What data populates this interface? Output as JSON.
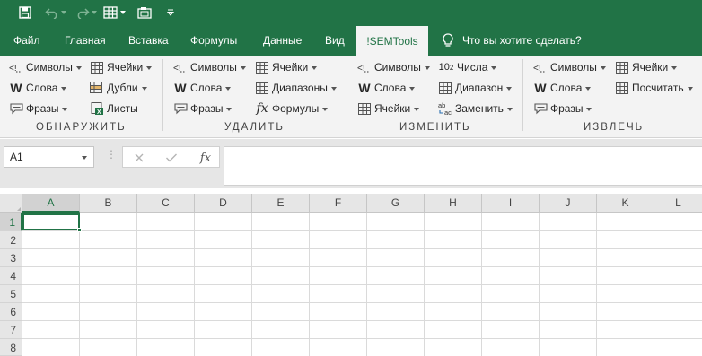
{
  "quick_access": {
    "icons": [
      "save-icon",
      "undo-icon",
      "redo-icon",
      "table-icon",
      "camera-icon",
      "customize-icon"
    ]
  },
  "tabs": [
    {
      "label": "Файл"
    },
    {
      "label": "Главная"
    },
    {
      "label": "Вставка"
    },
    {
      "label": "Формулы"
    },
    {
      "label": "Данные"
    },
    {
      "label": "Вид"
    },
    {
      "label": "!SEMTools",
      "active": true
    }
  ],
  "tell_me": {
    "label": "Что вы хотите сделать?"
  },
  "ribbon": {
    "detect": {
      "label": "ОБНАРУЖИТЬ",
      "symbols": "Символы",
      "cells": "Ячейки",
      "words": "Слова",
      "duplicates": "Дубли",
      "phrases": "Фразы",
      "sheets": "Листы"
    },
    "remove": {
      "label": "УДАЛИТЬ",
      "symbols": "Символы",
      "cells": "Ячейки",
      "words": "Слова",
      "ranges": "Диапазоны",
      "phrases": "Фразы",
      "formulas": "Формулы"
    },
    "change": {
      "label": "ИЗМЕНИТЬ",
      "symbols": "Символы",
      "numbers": "Числа",
      "words": "Слова",
      "range": "Диапазон",
      "cells": "Ячейки",
      "replace": "Заменить"
    },
    "extract": {
      "label": "ИЗВЛЕЧЬ",
      "symbols": "Символы",
      "cells": "Ячейки",
      "words": "Слова",
      "count": "Посчитать",
      "phrases": "Фразы"
    }
  },
  "formula_bar": {
    "name_box": "A1",
    "dots": "⋮",
    "formula_value": ""
  },
  "sheet": {
    "columns": [
      "A",
      "B",
      "C",
      "D",
      "E",
      "F",
      "G",
      "H",
      "I",
      "J",
      "K",
      "L"
    ],
    "rows": [
      "1",
      "2",
      "3",
      "4",
      "5",
      "6",
      "7",
      "8"
    ],
    "selected_cell": "A1"
  },
  "colors": {
    "brand": "#217346",
    "ribbon_bg": "#f3f3f3",
    "header_bg": "#e6e6e6"
  }
}
